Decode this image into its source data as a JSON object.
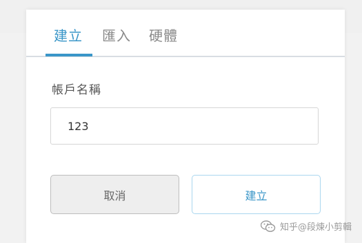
{
  "tabs": [
    {
      "label": "建立",
      "active": true
    },
    {
      "label": "匯入",
      "active": false
    },
    {
      "label": "硬體",
      "active": false
    }
  ],
  "form": {
    "account_name_label": "帳戶名稱",
    "account_name_value": "123"
  },
  "buttons": {
    "cancel_label": "取消",
    "create_label": "建立"
  },
  "watermark": {
    "text": "知乎@段煉小剪輯"
  },
  "colors": {
    "accent": "#3a96c8",
    "cancel_bg": "#eeeeee",
    "page_bg": "#f2f2f2"
  }
}
